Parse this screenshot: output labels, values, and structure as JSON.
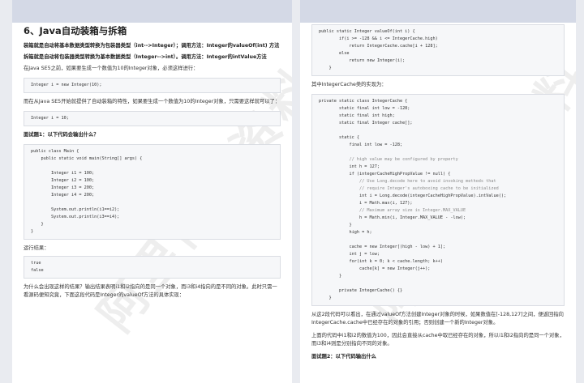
{
  "left": {
    "title": "6、Java自动装箱与拆箱",
    "p_boxing": "装箱就是自动将基本数据类型转换为包装器类型（int-->Integer）；调用方法：Integer的valueOf(int) 方法",
    "p_unboxing": "拆箱就是自动将包装器类型转换为基本数据类型（Integer-->int）。调用方法：Integer的intValue方法",
    "p_se5_before": "在Java SE5之前，如果要生成一个数值为10的Integer对象，必须这样进行：",
    "code1": [
      "Integer i = new Integer(10);"
    ],
    "p_se5_after": "而在从Java SE5开始就提供了自动装箱的特性，如果要生成一个数值为10的Integer对象，只需要这样就可以了：",
    "code2": [
      "Integer i = 10;"
    ],
    "q1": "面试题1：以下代码会输出什么？",
    "code3": [
      "public class Main {",
      "    public static void main(String[] args) {",
      "",
      "        Integer i1 = 100;",
      "        Integer i2 = 100;",
      "        Integer i3 = 200;",
      "        Integer i4 = 200;",
      "",
      "        System.out.println(i1==i2);",
      "        System.out.println(i3==i4);",
      "    }",
      "}"
    ],
    "result_label": "运行结果：",
    "code4": [
      "true",
      "false"
    ],
    "p_why": "为什么会出现这样的结果？输出结果表明i1和i2指向的是同一个对象，而i3和i4指向的是不同的对象。此时只需一看源码便知究竟，下面这段代码是Integer的valueOf方法的具体实现："
  },
  "right": {
    "code_valueof": [
      "public static Integer valueOf(int i) {",
      "        if(i >= -128 && i <= IntegerCache.high)",
      "            return IntegerCache.cache[i + 128];",
      "        else",
      "            return new Integer(i);",
      "    }"
    ],
    "p_cache_impl": "其中IntegerCache类的实现为：",
    "code_cache": [
      "private static class IntegerCache {",
      "        static final int low = -128;",
      "        static final int high;",
      "        static final Integer cache[];",
      "",
      "        static {",
      "            final int low = -128;",
      "",
      "            // high value may be configured by property",
      "            int h = 127;",
      "            if (integerCacheHighPropValue != null) {",
      "                // Use Long.decode here to avoid invoking methods that",
      "                // require Integer's autoboxing cache to be initialized",
      "                int i = Long.decode(integerCacheHighPropValue).intValue();",
      "                i = Math.max(i, 127);",
      "                // Maximum array size is Integer.MAX_VALUE",
      "                h = Math.min(i, Integer.MAX_VALUE - -low);",
      "            }",
      "            high = h;",
      "",
      "            cache = new Integer[(high - low) + 1];",
      "            int j = low;",
      "            for(int k = 0; k < cache.length; k++)",
      "                cache[k] = new Integer(j++);",
      "        }",
      "",
      "        private IntegerCache() {}",
      "    }"
    ],
    "p_analysis": "从这2段代码可以看出，在通过valueOf方法创建Integer对象的时候，如果数值在[-128,127]之间，便返回指向IntegerCache.cache中已经存在的对象的引用；否则创建一个新的Integer对象。",
    "p_conclusion": "上面的代码中i1和i2的数值为100，因此会直接从cache中取已经存在的对象，所以i1和i2指向的是同一个对象，而i3和i4则是分别指向不同的对象。",
    "q2": "面试题2：以下代码输出什么"
  },
  "watermark": "阿里内部资料"
}
